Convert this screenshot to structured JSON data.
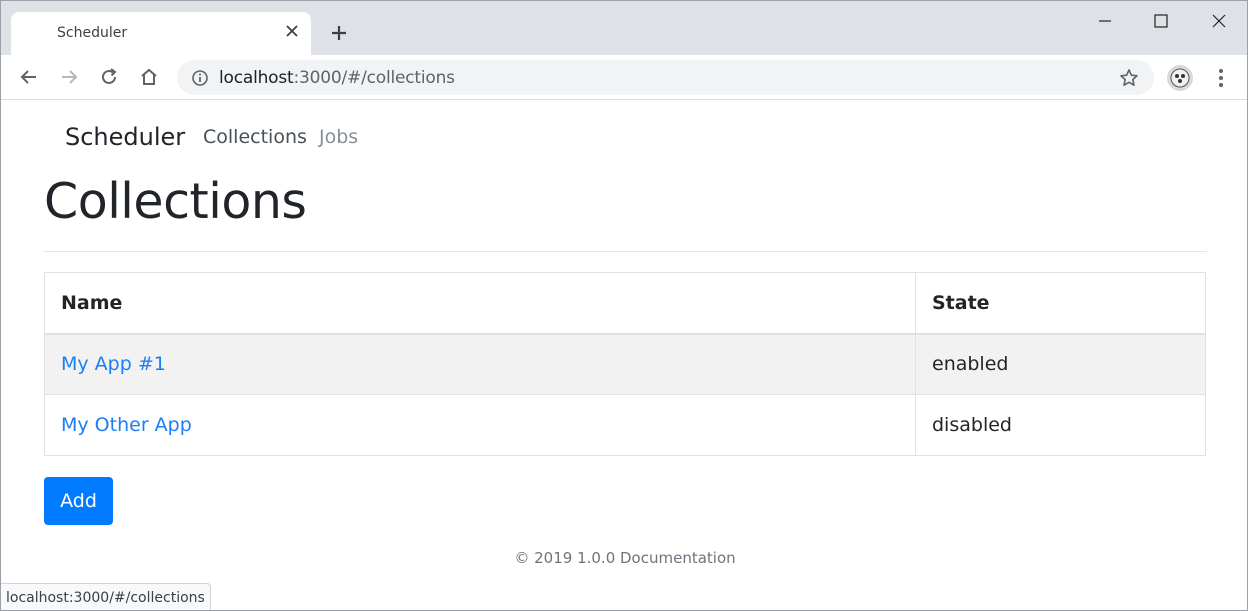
{
  "browser": {
    "tab_title": "Scheduler",
    "url_host": "localhost",
    "url_rest": ":3000/#/collections",
    "status_url": "localhost:3000/#/collections"
  },
  "navbar": {
    "brand": "Scheduler",
    "links": [
      {
        "label": "Collections",
        "active": true
      },
      {
        "label": "Jobs",
        "active": false
      }
    ]
  },
  "main": {
    "title": "Collections",
    "table": {
      "headers": [
        "Name",
        "State"
      ],
      "rows": [
        {
          "name": "My App #1",
          "state": "enabled"
        },
        {
          "name": "My Other App",
          "state": "disabled"
        }
      ]
    },
    "add_label": "Add"
  },
  "footer": {
    "text": "© 2019 1.0.0 Documentation"
  },
  "colors": {
    "primary": "#007bff",
    "link": "#1a7ff5",
    "tabstrip": "#dee1e6"
  }
}
